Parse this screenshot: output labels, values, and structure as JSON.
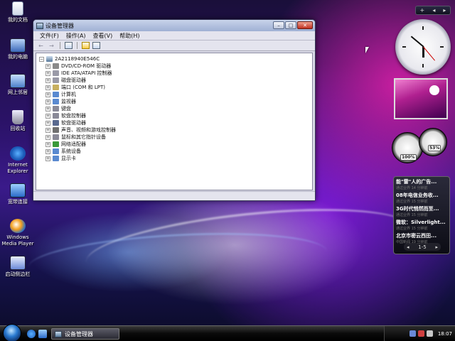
{
  "desktop": {
    "icons": [
      {
        "label": "我的文档",
        "icon": "documents-icon"
      },
      {
        "label": "我的电脑",
        "icon": "computer-icon"
      },
      {
        "label": "网上邻居",
        "icon": "network-icon"
      },
      {
        "label": "回收站",
        "icon": "recycle-bin-icon"
      },
      {
        "label": "Internet Explorer",
        "icon": "internet-explorer-icon"
      },
      {
        "label": "宽带连接",
        "icon": "broadband-icon"
      },
      {
        "label": "Windows Media Player",
        "icon": "media-player-icon"
      },
      {
        "label": "启动侧边栏",
        "icon": "sidebar-launcher-icon"
      }
    ]
  },
  "window": {
    "title": "设备管理器",
    "controls": {
      "minimize": "–",
      "maximize": "□",
      "close": "✕"
    },
    "menu": [
      "文件(F)",
      "操作(A)",
      "查看(V)",
      "帮助(H)"
    ],
    "toolbar": {
      "back": "←",
      "forward": "→"
    },
    "tree": {
      "root": "2A2118940E546C",
      "items": [
        {
          "label": "DVD/CD-ROM 驱动器",
          "icon": "dvd-drive-icon",
          "color": "#8a8a8a"
        },
        {
          "label": "IDE ATA/ATAPI 控制器",
          "icon": "ide-controller-icon",
          "color": "#9a9aa8"
        },
        {
          "label": "磁盘驱动器",
          "icon": "disk-drive-icon",
          "color": "#9a9aa8"
        },
        {
          "label": "端口 (COM 和 LPT)",
          "icon": "port-icon",
          "color": "#c8b060"
        },
        {
          "label": "计算机",
          "icon": "computer-node-icon",
          "color": "#5a8ad0"
        },
        {
          "label": "监视器",
          "icon": "monitor-icon",
          "color": "#5a8ad0"
        },
        {
          "label": "键盘",
          "icon": "keyboard-icon",
          "color": "#8a8a98"
        },
        {
          "label": "软盘控制器",
          "icon": "floppy-controller-icon",
          "color": "#8a8a98"
        },
        {
          "label": "软盘驱动器",
          "icon": "floppy-drive-icon",
          "color": "#5a6a90"
        },
        {
          "label": "声音、视频和游戏控制器",
          "icon": "sound-icon",
          "color": "#707070"
        },
        {
          "label": "鼠标和其它指针设备",
          "icon": "mouse-icon",
          "color": "#8a8a98"
        },
        {
          "label": "网络适配器",
          "icon": "network-adapter-icon",
          "color": "#3a9a3a"
        },
        {
          "label": "系统设备",
          "icon": "system-device-icon",
          "color": "#5a8ad0"
        },
        {
          "label": "显示卡",
          "icon": "display-adapter-icon",
          "color": "#5a8ad0"
        }
      ]
    }
  },
  "sidebar": {
    "controls": {
      "add": "+",
      "prev": "◂",
      "next": "▸"
    },
    "meters": {
      "cpu": "100%",
      "memory": "53%"
    },
    "news": {
      "items": [
        {
          "title": "能\"雷\"人的广告...",
          "sub": "通过业界 14 分钟前"
        },
        {
          "title": "08年电信业务收...",
          "sub": "通过业界 15 分钟前"
        },
        {
          "title": "3G时代悄然而至...",
          "sub": "通过业界 15 分钟前"
        },
        {
          "title": "微软：Silverlight...",
          "sub": "通过业界 15 分钟前"
        },
        {
          "title": "北京市密云西田...",
          "sub": "中国新闻 19 分钟前"
        }
      ],
      "pager": "1-5",
      "prev": "◂",
      "next": "▸"
    }
  },
  "taskbar": {
    "task_label": "设备管理器",
    "time": "18:07"
  }
}
